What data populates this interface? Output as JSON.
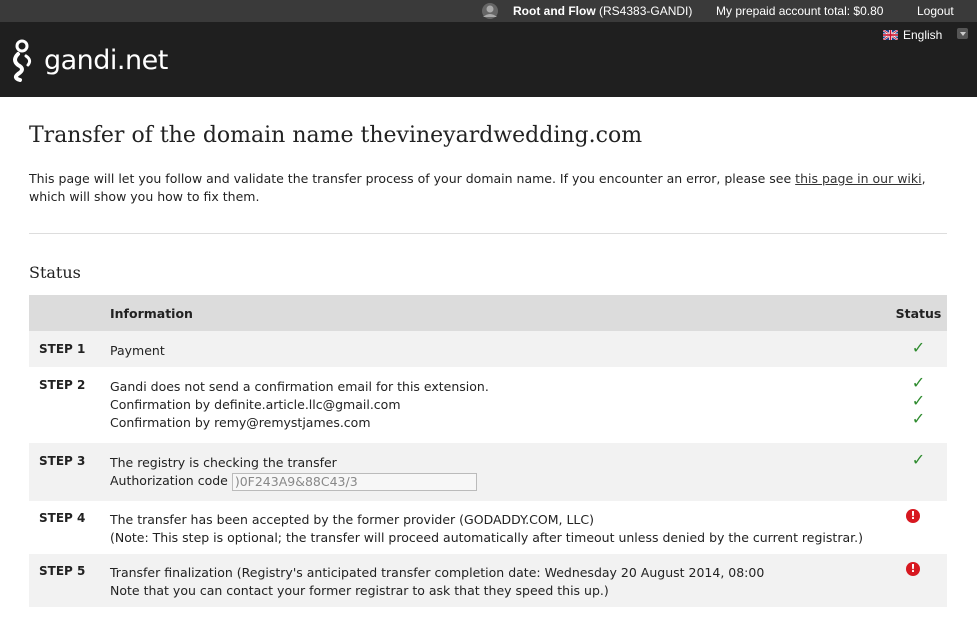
{
  "topbar": {
    "account_name": "Root and Flow",
    "account_handle": "(RS4383-GANDI)",
    "balance": "My prepaid account total: $0.80",
    "logout": "Logout"
  },
  "header": {
    "logo_text": "gandi.net",
    "language": "English"
  },
  "page": {
    "title": "Transfer of the domain name thevineyardwedding.com",
    "intro_before": "This page will let you follow and validate the transfer process of your domain name. If you encounter an error, please see ",
    "intro_link": "this page in our wiki",
    "intro_after": ", which will show you how to fix them.",
    "status_heading": "Status"
  },
  "table": {
    "headers": {
      "information": "Information",
      "status": "Status"
    },
    "steps": [
      {
        "label": "STEP 1",
        "lines": [
          "Payment"
        ],
        "statuses": [
          "ok"
        ]
      },
      {
        "label": "STEP 2",
        "lines": [
          "Gandi does not send a confirmation email for this extension.",
          "Confirmation by definite.article.llc@gmail.com",
          "Confirmation by remy@remystjames.com"
        ],
        "statuses": [
          "ok",
          "ok",
          "ok"
        ]
      },
      {
        "label": "STEP 3",
        "lines": [
          "The registry is checking the transfer"
        ],
        "auth_label": "Authorization code",
        "auth_value": ")0F243A9&88C43/3",
        "statuses": [
          "ok"
        ]
      },
      {
        "label": "STEP 4",
        "lines": [
          "The transfer has been accepted by the former provider (GODADDY.COM, LLC)",
          "(Note: This step is optional; the transfer will proceed automatically after timeout unless denied by the current registrar.)"
        ],
        "statuses": [
          "error"
        ]
      },
      {
        "label": "STEP 5",
        "lines": [
          "Transfer finalization (Registry's anticipated transfer completion date: Wednesday 20 August 2014, 08:00",
          "Note that you can contact your former registrar to ask that they speed this up.)"
        ],
        "statuses": [
          "error"
        ]
      }
    ]
  },
  "icons": {
    "ok": "✓",
    "error": "!"
  },
  "colors": {
    "ok": "#2e8b2e",
    "error": "#d71820",
    "header_bg": "#1f1f1f",
    "topbar_bg": "#3a3a3a"
  }
}
